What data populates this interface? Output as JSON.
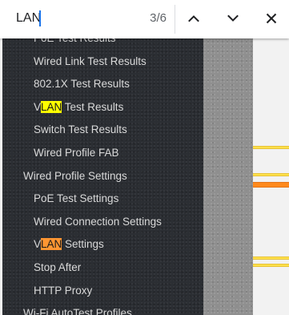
{
  "find_bar": {
    "query": "LAN",
    "match_count": "3/6",
    "icons": {
      "previous": "chevron-up-icon",
      "next": "chevron-down-icon",
      "close": "close-icon"
    }
  },
  "sidebar": {
    "items": [
      {
        "level": 2,
        "parts": [
          {
            "text": "PoE Test Results"
          }
        ]
      },
      {
        "level": 2,
        "parts": [
          {
            "text": "Wired Link Test Results"
          }
        ]
      },
      {
        "level": 2,
        "parts": [
          {
            "text": "802.1X Test Results"
          }
        ]
      },
      {
        "level": 2,
        "parts": [
          {
            "text": "V"
          },
          {
            "text": "LAN",
            "hl": "match"
          },
          {
            "text": " Test Results"
          }
        ]
      },
      {
        "level": 2,
        "parts": [
          {
            "text": "Switch Test Results"
          }
        ]
      },
      {
        "level": 2,
        "parts": [
          {
            "text": "Wired Profile FAB"
          }
        ]
      },
      {
        "level": 1,
        "parts": [
          {
            "text": "Wired Profile Settings"
          }
        ]
      },
      {
        "level": 2,
        "parts": [
          {
            "text": "PoE Test Settings"
          }
        ]
      },
      {
        "level": 2,
        "parts": [
          {
            "text": "Wired Connection Settings"
          }
        ]
      },
      {
        "level": 2,
        "parts": [
          {
            "text": "V"
          },
          {
            "text": "LAN",
            "hl": "current"
          },
          {
            "text": " Settings"
          }
        ]
      },
      {
        "level": 2,
        "parts": [
          {
            "text": "Stop After"
          }
        ]
      },
      {
        "level": 2,
        "parts": [
          {
            "text": "HTTP Proxy"
          }
        ]
      },
      {
        "level": 1,
        "parts": [
          {
            "text": "Wi-Fi AutoTest Profiles"
          }
        ]
      }
    ]
  },
  "colors": {
    "match_highlight": "#ffff00",
    "current_match_highlight": "#ff9632",
    "sidebar_background": "#2b2e33",
    "caret": "#1a73e8"
  }
}
